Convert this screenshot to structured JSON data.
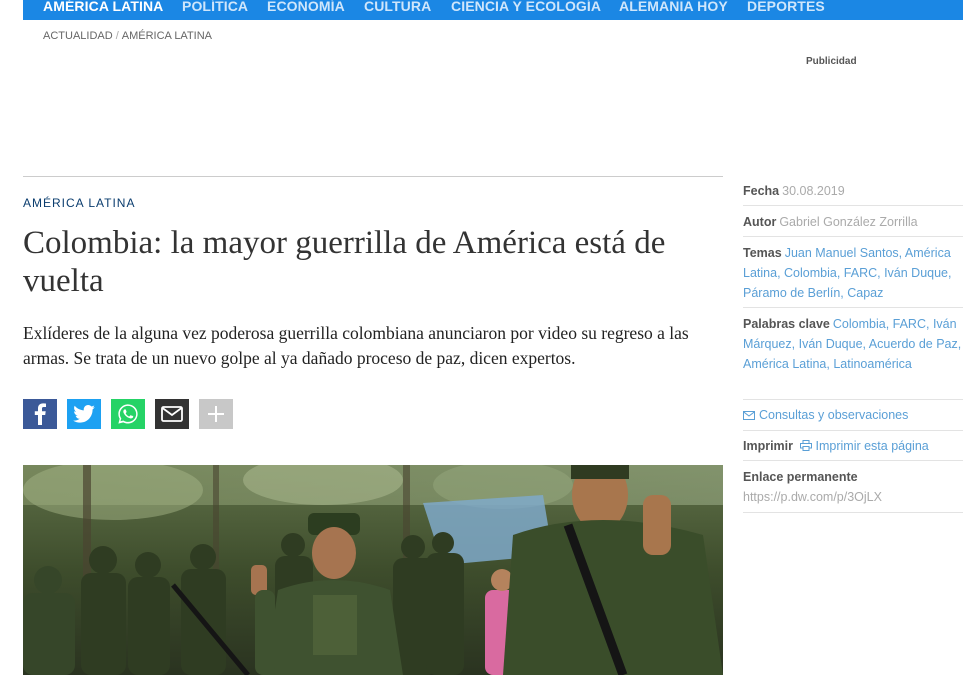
{
  "nav": {
    "items": [
      {
        "label": "AMÉRICA LATINA",
        "active": true
      },
      {
        "label": "POLÍTICA",
        "active": false
      },
      {
        "label": "ECONOMÍA",
        "active": false
      },
      {
        "label": "CULTURA",
        "active": false
      },
      {
        "label": "CIENCIA Y ECOLOGÍA",
        "active": false
      },
      {
        "label": "ALEMANIA HOY",
        "active": false
      },
      {
        "label": "DEPORTES",
        "active": false
      }
    ]
  },
  "breadcrumb": {
    "items": [
      "ACTUALIDAD",
      "AMÉRICA LATINA"
    ],
    "separator": "/"
  },
  "ad": {
    "label": "Publicidad"
  },
  "article": {
    "kicker": "AMÉRICA LATINA",
    "headline": "Colombia: la mayor guerrilla de América está de vuelta",
    "teaser": "Exlíderes de la alguna vez poderosa guerrilla colombiana anunciaron por video su regreso a las armas. Se trata de un nuevo golpe al ya dañado proceso de paz, dicen expertos."
  },
  "share": {
    "buttons": [
      {
        "icon": "facebook-icon",
        "color": "#3b5998"
      },
      {
        "icon": "twitter-icon",
        "color": "#1da1f2"
      },
      {
        "icon": "whatsapp-icon",
        "color": "#25d366"
      },
      {
        "icon": "mail-icon",
        "color": "#333333"
      },
      {
        "icon": "plus-icon",
        "color": "#c8c8c8"
      }
    ]
  },
  "sidebar": {
    "fecha": {
      "label": "Fecha",
      "value": "30.08.2019"
    },
    "autor": {
      "label": "Autor",
      "value": "Gabriel González Zorrilla"
    },
    "temas": {
      "label": "Temas",
      "links": [
        "Juan Manuel Santos",
        "América Latina",
        "Colombia",
        "FARC",
        "Iván Duque",
        "Páramo de Berlín",
        "Capaz"
      ]
    },
    "palabras": {
      "label": "Palabras clave",
      "links": [
        "Colombia",
        "FARC",
        "Iván Márquez",
        "Iván Duque",
        "Acuerdo de Paz",
        "América Latina",
        "Latinoamérica"
      ]
    },
    "consultas": {
      "label": "Consultas y observaciones",
      "icon": "mail-icon"
    },
    "imprimir": {
      "label": "Imprimir",
      "link": "Imprimir esta página",
      "icon": "printer-icon"
    },
    "enlace": {
      "label": "Enlace permanente",
      "url": "https://p.dw.com/p/3OjLX"
    }
  },
  "colors": {
    "nav_bg": "#1b87e4",
    "kicker": "#0a3c6e",
    "link": "#5a9fd6"
  }
}
